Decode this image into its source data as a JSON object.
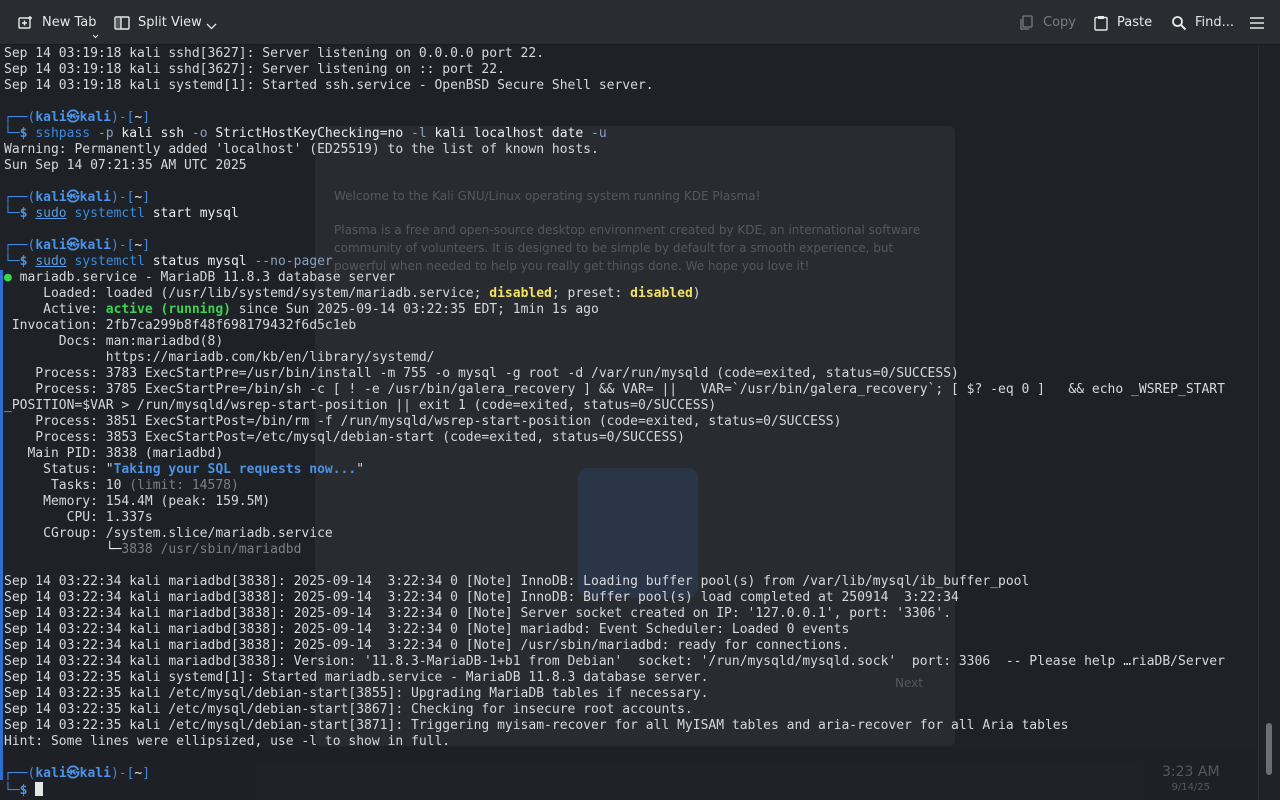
{
  "toolbar": {
    "new_tab": "New Tab",
    "split_view": "Split View",
    "copy": "Copy",
    "paste": "Paste",
    "find": "Find..."
  },
  "background": {
    "welcome": "Welcome to the Kali GNU/Linux operating system running KDE Plasma!",
    "description": "Plasma is a free and open-source desktop environment created by KDE, an international software community of volunteers. It is designed to be simple by default for a smooth experience, but powerful when needed to help you really get things done. We hope you love it!",
    "next": "Next",
    "clock_time": "3:23 AM",
    "clock_date": "9/14/25"
  },
  "colors": {
    "prompt": "#3d8ae0",
    "active": "#3bd34f",
    "disabled": "#f0e160",
    "status_text": "#4b93e6",
    "background": "#1e2126"
  },
  "scroll": {
    "position_fraction": 0.97,
    "visible_fraction": 0.07
  },
  "terminal": {
    "lines": [
      [
        {
          "t": "Sep 14 03:19:18 kali sshd[3627]: Server listening on 0.0.0.0 port 22."
        }
      ],
      [
        {
          "t": "Sep 14 03:19:18 kali sshd[3627]: Server listening on :: port 22."
        }
      ],
      [
        {
          "t": "Sep 14 03:19:18 kali systemd[1]: Started ssh.service - OpenBSD Secure Shell server."
        }
      ],
      [
        {
          "t": ""
        }
      ],
      [
        {
          "t": "┌──(",
          "c": "blue"
        },
        {
          "t": "kali㉿kali",
          "c": "bluebold"
        },
        {
          "t": ")-[",
          "c": "blue"
        },
        {
          "t": "~",
          "c": "cmd"
        },
        {
          "t": "]",
          "c": "blue"
        }
      ],
      [
        {
          "t": "└─",
          "c": "blue"
        },
        {
          "t": "$ ",
          "c": "bluebold"
        },
        {
          "t": "sshpass",
          "c": "blue"
        },
        {
          "t": " -p",
          "c": "arg"
        },
        {
          "t": " kali ssh",
          "c": "cmd"
        },
        {
          "t": " -o",
          "c": "arg"
        },
        {
          "t": " StrictHostKeyChecking=no",
          "c": "cmd"
        },
        {
          "t": " -l",
          "c": "arg"
        },
        {
          "t": " kali localhost date",
          "c": "cmd"
        },
        {
          "t": " -u",
          "c": "arg"
        }
      ],
      [
        {
          "t": "Warning: Permanently added 'localhost' (ED25519) to the list of known hosts."
        }
      ],
      [
        {
          "t": "Sun Sep 14 07:21:35 AM UTC 2025"
        }
      ],
      [
        {
          "t": ""
        }
      ],
      [
        {
          "t": "┌──(",
          "c": "blue"
        },
        {
          "t": "kali㉿kali",
          "c": "bluebold"
        },
        {
          "t": ")-[",
          "c": "blue"
        },
        {
          "t": "~",
          "c": "cmd"
        },
        {
          "t": "]",
          "c": "blue"
        }
      ],
      [
        {
          "t": "└─",
          "c": "blue"
        },
        {
          "t": "$ ",
          "c": "bluebold"
        },
        {
          "t": "sudo",
          "c": "undl"
        },
        {
          "t": " systemctl",
          "c": "blue"
        },
        {
          "t": " start mysql",
          "c": "cmd"
        }
      ],
      [
        {
          "t": ""
        }
      ],
      [
        {
          "t": "┌──(",
          "c": "blue"
        },
        {
          "t": "kali㉿kali",
          "c": "bluebold"
        },
        {
          "t": ")-[",
          "c": "blue"
        },
        {
          "t": "~",
          "c": "cmd"
        },
        {
          "t": "]",
          "c": "blue"
        }
      ],
      [
        {
          "t": "└─",
          "c": "blue"
        },
        {
          "t": "$ ",
          "c": "bluebold"
        },
        {
          "t": "sudo",
          "c": "undl"
        },
        {
          "t": " systemctl",
          "c": "blue"
        },
        {
          "t": " status mysql",
          "c": "cmd"
        },
        {
          "t": " --no-pager",
          "c": "arg"
        }
      ],
      [
        {
          "t": "●",
          "c": "bullet"
        },
        {
          "t": " mariadb.service - MariaDB 11.8.3 database server"
        }
      ],
      [
        {
          "t": "     Loaded: loaded (/usr/lib/systemd/system/mariadb.service; "
        },
        {
          "t": "disabled",
          "c": "yellow"
        },
        {
          "t": "; preset: "
        },
        {
          "t": "disabled",
          "c": "yellow"
        },
        {
          "t": ")"
        }
      ],
      [
        {
          "t": "     Active: "
        },
        {
          "t": "active (running)",
          "c": "green"
        },
        {
          "t": " since Sun 2025-09-14 03:22:35 EDT; 1min 1s ago"
        }
      ],
      [
        {
          "t": " Invocation: 2fb7ca299b8f48f698179432f6d5c1eb"
        }
      ],
      [
        {
          "t": "       Docs: man:mariadbd(8)"
        }
      ],
      [
        {
          "t": "             https://mariadb.com/kb/en/library/systemd/"
        }
      ],
      [
        {
          "t": "    Process: 3783 ExecStartPre=/usr/bin/install -m 755 -o mysql -g root -d /var/run/mysqld (code=exited, status=0/SUCCESS)"
        }
      ],
      [
        {
          "t": "    Process: 3785 ExecStartPre=/bin/sh -c [ ! -e /usr/bin/galera_recovery ] && VAR= ||   VAR=`/usr/bin/galera_recovery`; [ $? -eq 0 ]   && echo _WSREP_START"
        }
      ],
      [
        {
          "t": "_POSITION=$VAR > /run/mysqld/wsrep-start-position || exit 1 (code=exited, status=0/SUCCESS)"
        }
      ],
      [
        {
          "t": "    Process: 3851 ExecStartPost=/bin/rm -f /run/mysqld/wsrep-start-position (code=exited, status=0/SUCCESS)"
        }
      ],
      [
        {
          "t": "    Process: 3853 ExecStartPost=/etc/mysql/debian-start (code=exited, status=0/SUCCESS)"
        }
      ],
      [
        {
          "t": "   Main PID: 3838 (mariadbd)"
        }
      ],
      [
        {
          "t": "     Status: \""
        },
        {
          "t": "Taking your SQL requests now...",
          "c": "bluebold"
        },
        {
          "t": "\""
        }
      ],
      [
        {
          "t": "      Tasks: 10 "
        },
        {
          "t": "(limit: 14578)",
          "c": "dim"
        }
      ],
      [
        {
          "t": "     Memory: 154.4M (peak: 159.5M)"
        }
      ],
      [
        {
          "t": "        CPU: 1.337s"
        }
      ],
      [
        {
          "t": "     CGroup: /system.slice/mariadb.service"
        }
      ],
      [
        {
          "t": "             └─",
          "c": "cmd"
        },
        {
          "t": "3838 /usr/sbin/mariadbd",
          "c": "dim"
        }
      ],
      [
        {
          "t": ""
        }
      ],
      [
        {
          "t": "Sep 14 03:22:34 kali mariadbd[3838]: 2025-09-14  3:22:34 0 [Note] InnoDB: Loading buffer pool(s) from /var/lib/mysql/ib_buffer_pool"
        }
      ],
      [
        {
          "t": "Sep 14 03:22:34 kali mariadbd[3838]: 2025-09-14  3:22:34 0 [Note] InnoDB: Buffer pool(s) load completed at 250914  3:22:34"
        }
      ],
      [
        {
          "t": "Sep 14 03:22:34 kali mariadbd[3838]: 2025-09-14  3:22:34 0 [Note] Server socket created on IP: '127.0.0.1', port: '3306'."
        }
      ],
      [
        {
          "t": "Sep 14 03:22:34 kali mariadbd[3838]: 2025-09-14  3:22:34 0 [Note] mariadbd: Event Scheduler: Loaded 0 events"
        }
      ],
      [
        {
          "t": "Sep 14 03:22:34 kali mariadbd[3838]: 2025-09-14  3:22:34 0 [Note] /usr/sbin/mariadbd: ready for connections."
        }
      ],
      [
        {
          "t": "Sep 14 03:22:34 kali mariadbd[3838]: Version: '11.8.3-MariaDB-1+b1 from Debian'  socket: '/run/mysqld/mysqld.sock'  port: 3306  -- Please help …riaDB/Server"
        }
      ],
      [
        {
          "t": "Sep 14 03:22:35 kali systemd[1]: Started mariadb.service - MariaDB 11.8.3 database server."
        }
      ],
      [
        {
          "t": "Sep 14 03:22:35 kali /etc/mysql/debian-start[3855]: Upgrading MariaDB tables if necessary."
        }
      ],
      [
        {
          "t": "Sep 14 03:22:35 kali /etc/mysql/debian-start[3867]: Checking for insecure root accounts."
        }
      ],
      [
        {
          "t": "Sep 14 03:22:35 kali /etc/mysql/debian-start[3871]: Triggering myisam-recover for all MyISAM tables and aria-recover for all Aria tables"
        }
      ],
      [
        {
          "t": "Hint: Some lines were ellipsized, use -l to show in full."
        }
      ],
      [
        {
          "t": ""
        }
      ],
      [
        {
          "t": "┌──(",
          "c": "blue"
        },
        {
          "t": "kali㉿kali",
          "c": "bluebold"
        },
        {
          "t": ")-[",
          "c": "blue"
        },
        {
          "t": "~",
          "c": "cmd"
        },
        {
          "t": "]",
          "c": "blue"
        }
      ],
      [
        {
          "t": "└─",
          "c": "blue"
        },
        {
          "t": "$ ",
          "c": "bluebold"
        }
      ]
    ]
  }
}
